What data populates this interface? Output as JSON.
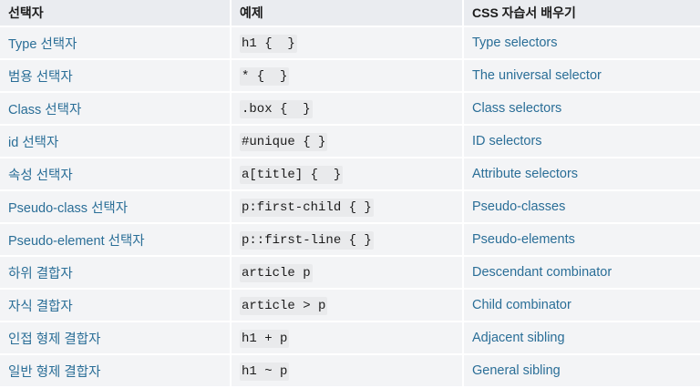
{
  "table": {
    "headers": [
      "선택자",
      "예제",
      "CSS 자습서 배우기"
    ],
    "rows": [
      {
        "selector": "Type 선택자",
        "example": "h1 {  }",
        "learn": "Type selectors"
      },
      {
        "selector": "범용 선택자",
        "example": "* {  }",
        "learn": "The universal selector"
      },
      {
        "selector": "Class 선택자",
        "example": ".box {  }",
        "learn": "Class selectors"
      },
      {
        "selector": "id 선택자",
        "example": "#unique { }",
        "learn": "ID selectors"
      },
      {
        "selector": "속성 선택자",
        "example": "a[title] {  }",
        "learn": "Attribute selectors"
      },
      {
        "selector": "Pseudo-class 선택자",
        "example": "p:first-child { }",
        "learn": "Pseudo-classes"
      },
      {
        "selector": "Pseudo-element 선택자",
        "example": "p::first-line { }",
        "learn": "Pseudo-elements"
      },
      {
        "selector": "하위 결합자",
        "example": "article p",
        "learn": "Descendant combinator"
      },
      {
        "selector": "자식 결합자",
        "example": "article > p",
        "learn": "Child combinator"
      },
      {
        "selector": "인접 형제 결합자",
        "example": "h1 + p",
        "learn": "Adjacent sibling"
      },
      {
        "selector": "일반 형제 결합자",
        "example": "h1 ~ p",
        "learn": "General sibling"
      }
    ]
  },
  "colors": {
    "link": "#2a6e97",
    "header_bg": "#eaecf0",
    "cell_bg": "#f3f4f6",
    "code_bg": "#e9eaec"
  }
}
